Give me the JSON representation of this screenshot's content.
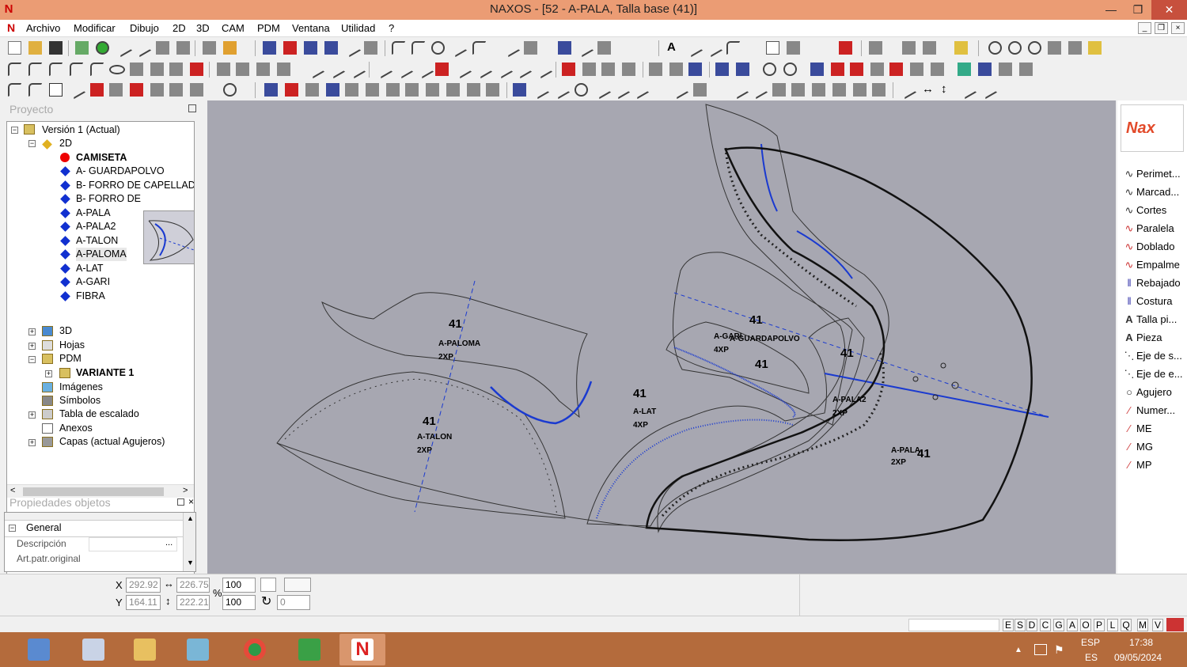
{
  "window": {
    "title": "NAXOS - [52 - A-PALA, Talla base (41)]",
    "minimize": "—",
    "maximize": "❐",
    "close": "✕"
  },
  "menu": {
    "logo": "N",
    "items": [
      "Archivo",
      "Modificar",
      "Dibujo",
      "2D",
      "3D",
      "CAM",
      "PDM",
      "Ventana",
      "Utilidad",
      "?"
    ],
    "mdi": [
      "_",
      "❐",
      "×"
    ]
  },
  "project_panel": {
    "header": "Proyecto",
    "tree": {
      "version": "Versión 1 (Actual)",
      "node_2d": "2D",
      "camiseta": "CAMISETA",
      "pieces": [
        "A- GUARDAPOLVO",
        "B- FORRO DE CAPELLADA",
        "B- FORRO DE",
        "A-PALA",
        "A-PALA2",
        "A-TALON",
        "A-PALOMA",
        "A-LAT",
        "A-GARI",
        "FIBRA"
      ],
      "node_3d": "3D",
      "hojas": "Hojas",
      "pdm": "PDM",
      "variante": "VARIANTE 1",
      "imagenes": "Imágenes",
      "simbolos": "Símbolos",
      "escalado": "Tabla de escalado",
      "anexos": "Anexos",
      "capas": "Capas (actual Agujeros)"
    }
  },
  "properties_panel": {
    "header": "Propiedades objetos",
    "group": "General",
    "rows": [
      "Descripción",
      "Art.patr.original"
    ],
    "ellipsis": "..."
  },
  "canvas": {
    "labels": [
      {
        "size": "41",
        "name": "A-PALOMA",
        "qty": "2XP"
      },
      {
        "size": "41",
        "name": "A-TALON",
        "qty": "2XP"
      },
      {
        "size": "41",
        "name": "A-LAT",
        "qty": "4XP"
      },
      {
        "size": "41",
        "name": "A-GUARDAPOLVO",
        "qty": ""
      },
      {
        "size": "41",
        "name": "A-GARI",
        "qty": "4XP"
      },
      {
        "size": "41",
        "name": "A-PALA2",
        "qty": "2XP"
      },
      {
        "size": "41",
        "name": "A-PALA",
        "qty": "2XP"
      }
    ]
  },
  "right_panel": {
    "logo": "Nax",
    "tools": [
      "Perimet...",
      "Marcad...",
      "Cortes",
      "Paralela",
      "Doblado",
      "Empalme",
      "Rebajado",
      "Costura",
      "Talla pi...",
      "Pieza",
      "Eje de s...",
      "Eje de e...",
      "Agujero",
      "Numer...",
      "ME",
      "MG",
      "MP"
    ],
    "icons": [
      "curve-icon",
      "curve-icon",
      "curve-icon",
      "parallel-icon",
      "fold-icon",
      "blend-icon",
      "skive-icon",
      "seam-icon",
      "text-icon",
      "text-icon",
      "axis-icon",
      "axis-icon",
      "circle-icon",
      "pen-icon",
      "pen-icon",
      "pen-icon",
      "pen-icon"
    ]
  },
  "status": {
    "x_label": "X",
    "y_label": "Y",
    "x": "292.92",
    "y": "164.11",
    "w": "226.75",
    "h": "222.21",
    "pct_label": "%",
    "scale_x": "100",
    "scale_y": "100",
    "rotation": "0",
    "letters": [
      "E",
      "S",
      "D",
      "C",
      "G",
      "A",
      "O",
      "P",
      "L",
      "Q",
      "M",
      "V"
    ]
  },
  "taskbar": {
    "lang": "ESP",
    "lang2": "ES",
    "time": "17:38",
    "date": "09/05/2024"
  }
}
